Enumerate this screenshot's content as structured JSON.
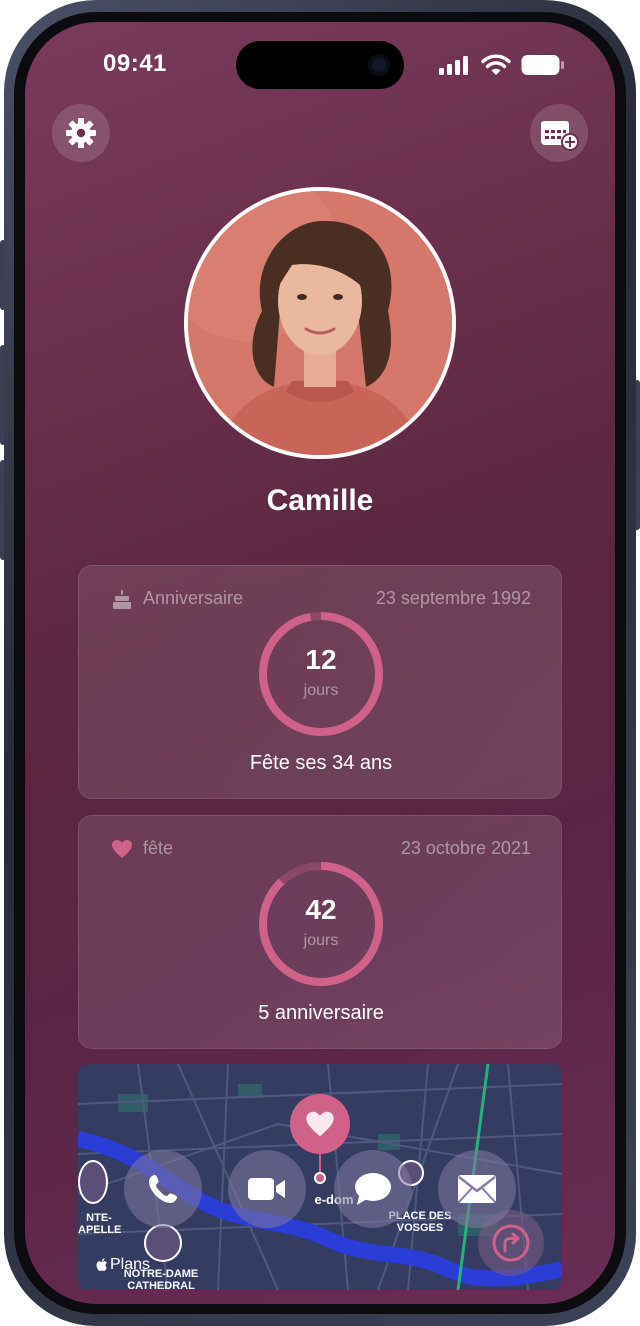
{
  "status": {
    "time": "09:41"
  },
  "profile": {
    "name": "Camille"
  },
  "cards": [
    {
      "label": "Anniversaire",
      "date": "23 septembre 1992",
      "count": "12",
      "unit": "jours",
      "caption": "Fête ses 34 ans",
      "progress": 0.97
    },
    {
      "label": "fête",
      "date": "23 octobre 2021",
      "count": "42",
      "unit": "jours",
      "caption": "5 anniversaire",
      "progress": 0.88
    }
  ],
  "map": {
    "provider": "Plans",
    "labels": {
      "left": "NTE-\nAPELLE",
      "center": "e-dom",
      "right": "PLACE DES\nVOSGES",
      "bottom": "NOTRE-DAME\nCATHEDRAL"
    }
  },
  "colors": {
    "accent": "#d0628a",
    "background": "#5c2740"
  }
}
